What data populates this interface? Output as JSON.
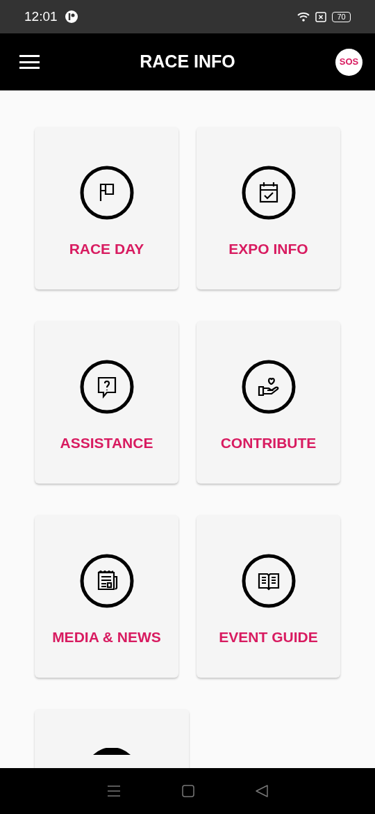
{
  "status_bar": {
    "time": "12:01",
    "battery": "70"
  },
  "header": {
    "title": "RACE INFO",
    "sos": "SOS"
  },
  "tiles": [
    {
      "kind": "flag",
      "label": "RACE DAY"
    },
    {
      "kind": "calendar",
      "label": "EXPO INFO"
    },
    {
      "kind": "question",
      "label": "ASSISTANCE"
    },
    {
      "kind": "heart-hand",
      "label": "CONTRIBUTE"
    },
    {
      "kind": "newspaper",
      "label": "MEDIA & NEWS"
    },
    {
      "kind": "book",
      "label": "EVENT GUIDE"
    },
    {
      "kind": "partial"
    }
  ]
}
